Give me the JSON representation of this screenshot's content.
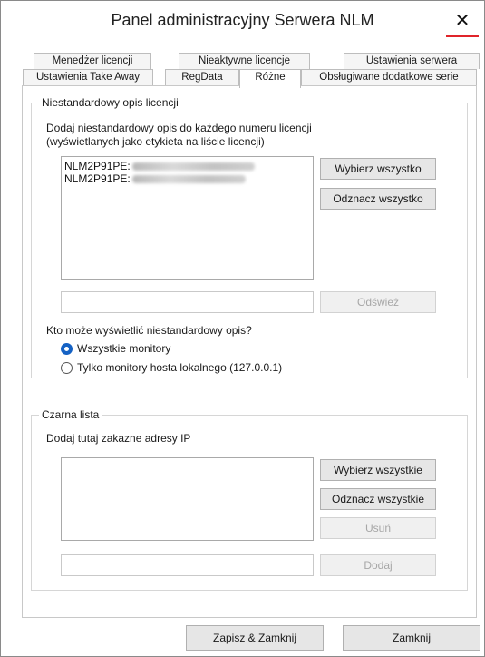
{
  "window": {
    "title": "Panel administracyjny Serwera NLM",
    "close_glyph": "✕",
    "accent_color": "#e0242a"
  },
  "tabs": {
    "row1": [
      "Menedżer licencji",
      "Nieaktywne licencje",
      "Ustawienia serwera"
    ],
    "row2": [
      "Ustawienia Take Away",
      "RegData",
      "Różne",
      "Obsługiwane dodatkowe serie"
    ],
    "active": "Różne"
  },
  "custom_desc": {
    "legend": "Niestandardowy opis licencji",
    "instruction_line1": "Dodaj niestandardowy opis do każdego numeru licencji",
    "instruction_line2": "(wyświetlanych jako etykieta na liście licencji)",
    "list_items": [
      "NLM2P91PE:",
      "NLM2P91PE:"
    ],
    "select_all_label": "Wybierz wszystko",
    "deselect_all_label": "Odznacz wszystko",
    "refresh_label": "Odśwież",
    "who_label": "Kto może wyświetlić niestandardowy opis?",
    "radio_all_label": "Wszystkie monitory",
    "radio_local_label": "Tylko monitory hosta lokalnego (127.0.0.1)",
    "radio_selected": "all"
  },
  "blacklist": {
    "legend": "Czarna lista",
    "instruction": "Dodaj tutaj zakazne adresy IP",
    "select_all_label": "Wybierz wszystkie",
    "deselect_all_label": "Odznacz wszystkie",
    "delete_label": "Usuń",
    "add_label": "Dodaj"
  },
  "footer": {
    "save_close_label": "Zapisz & Zamknij",
    "close_label": "Zamknij"
  }
}
